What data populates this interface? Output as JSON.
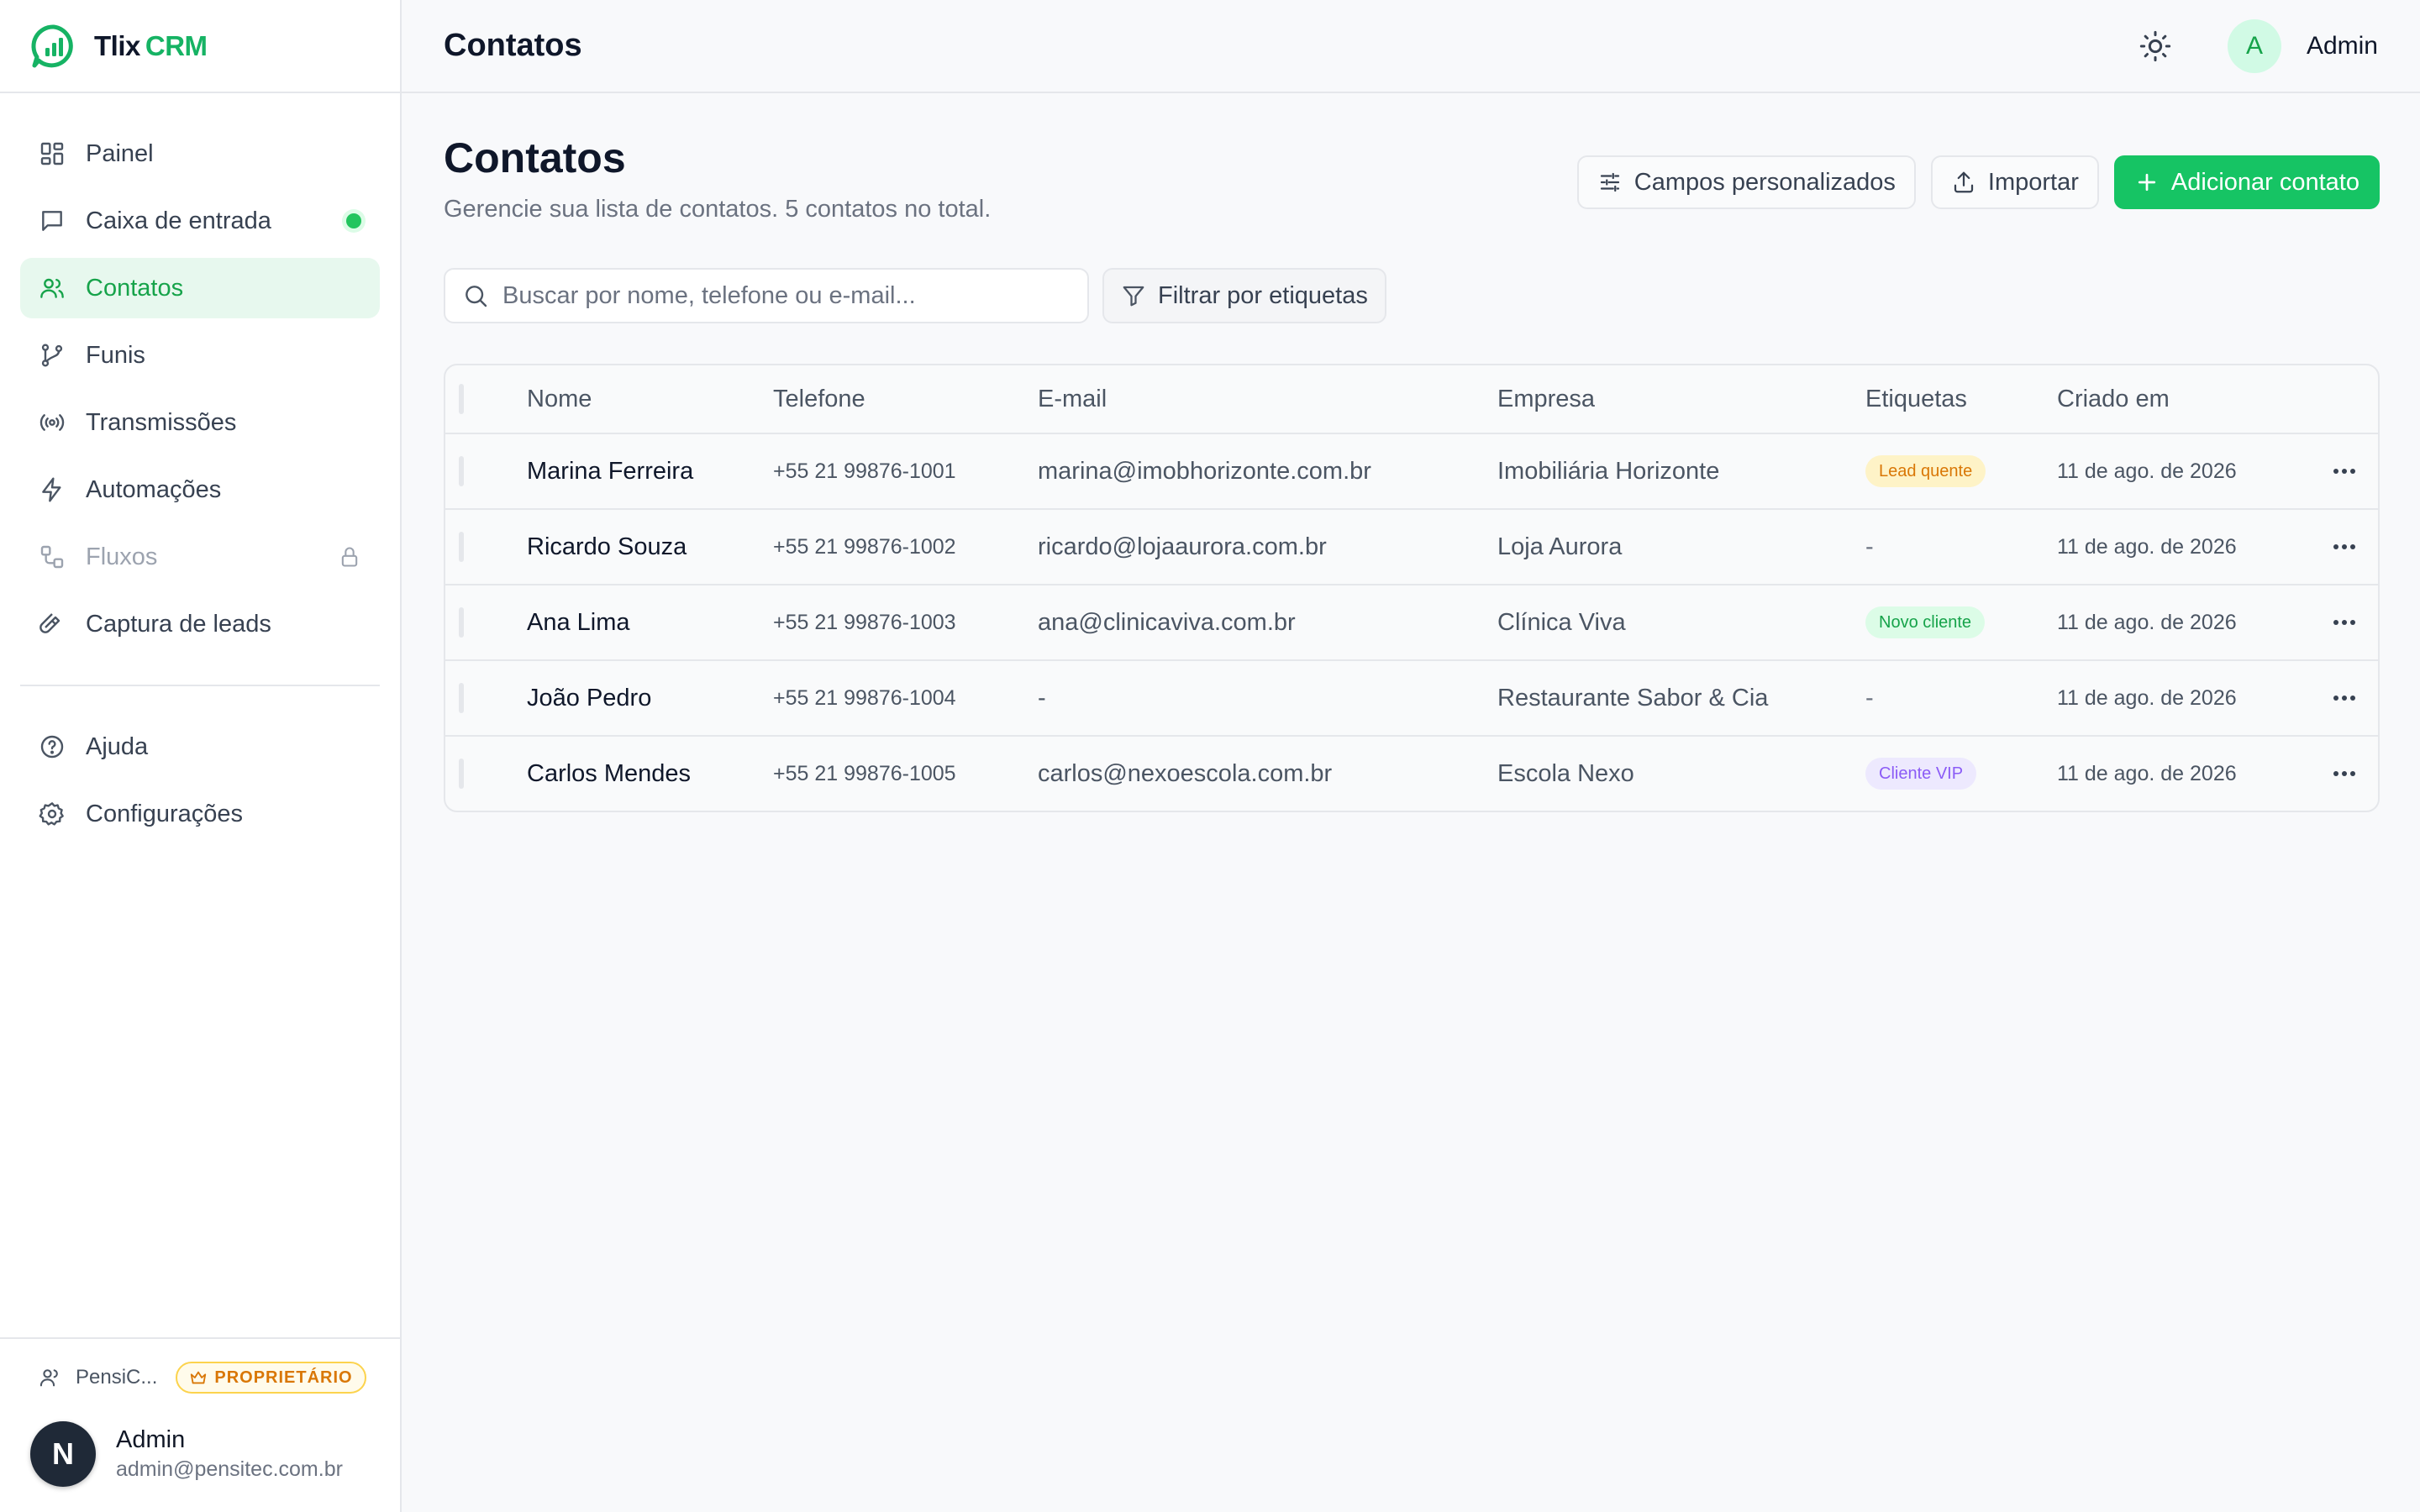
{
  "app": {
    "brand_primary": "Tlix",
    "brand_secondary": "CRM",
    "accent_color": "#16c464"
  },
  "sidebar": {
    "items": [
      {
        "label": "Painel",
        "icon": "dashboard-icon"
      },
      {
        "label": "Caixa de entrada",
        "icon": "message-icon",
        "status": "online-dot"
      },
      {
        "label": "Contatos",
        "icon": "users-icon",
        "active": true
      },
      {
        "label": "Funis",
        "icon": "git-branch-icon"
      },
      {
        "label": "Transmissões",
        "icon": "broadcast-icon"
      },
      {
        "label": "Automações",
        "icon": "lightning-icon"
      },
      {
        "label": "Fluxos",
        "icon": "workflow-icon",
        "locked": true
      },
      {
        "label": "Captura de leads",
        "icon": "magnet-icon"
      }
    ],
    "secondary_items": [
      {
        "label": "Ajuda",
        "icon": "help-circle-icon"
      },
      {
        "label": "Configurações",
        "icon": "gear-icon"
      }
    ],
    "footer": {
      "org_name": "PensiC...",
      "role_badge": "PROPRIETÁRIO",
      "user_initial": "N",
      "user_name": "Admin",
      "user_email": "admin@pensitec.com.br"
    }
  },
  "topbar": {
    "title": "Contatos",
    "user_initial": "A",
    "user_name": "Admin"
  },
  "page": {
    "title": "Contatos",
    "subtitle": "Gerencie sua lista de contatos. 5 contatos no total.",
    "actions": {
      "custom_fields": "Campos personalizados",
      "import": "Importar",
      "add_contact": "Adicionar contato"
    },
    "search_placeholder": "Buscar por nome, telefone ou e-mail...",
    "filter_label": "Filtrar por etiquetas"
  },
  "table": {
    "columns": [
      "Nome",
      "Telefone",
      "E-mail",
      "Empresa",
      "Etiquetas",
      "Criado em"
    ],
    "rows": [
      {
        "name": "Marina Ferreira",
        "phone": "+55 21 99876-1001",
        "email": "marina@imobhorizonte.com.br",
        "company": "Imobiliária Horizonte",
        "tag": "Lead quente",
        "tag_color": "amber",
        "created": "11 de ago. de 2026"
      },
      {
        "name": "Ricardo Souza",
        "phone": "+55 21 99876-1002",
        "email": "ricardo@lojaaurora.com.br",
        "company": "Loja Aurora",
        "tag": "-",
        "tag_color": "",
        "created": "11 de ago. de 2026"
      },
      {
        "name": "Ana Lima",
        "phone": "+55 21 99876-1003",
        "email": "ana@clinicaviva.com.br",
        "company": "Clínica Viva",
        "tag": "Novo cliente",
        "tag_color": "green",
        "created": "11 de ago. de 2026"
      },
      {
        "name": "João Pedro",
        "phone": "+55 21 99876-1004",
        "email": "-",
        "company": "Restaurante Sabor & Cia",
        "tag": "-",
        "tag_color": "",
        "created": "11 de ago. de 2026"
      },
      {
        "name": "Carlos Mendes",
        "phone": "+55 21 99876-1005",
        "email": "carlos@nexoescola.com.br",
        "company": "Escola Nexo",
        "tag": "Cliente VIP",
        "tag_color": "purple",
        "created": "11 de ago. de 2026"
      }
    ]
  }
}
